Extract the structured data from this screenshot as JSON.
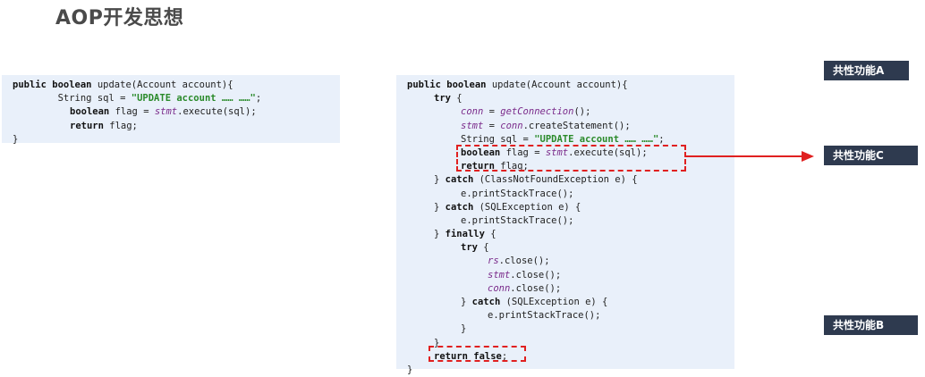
{
  "title": "AOP开发思想",
  "labels": {
    "common_a": "共性功能A",
    "common_c": "共性功能C",
    "common_b": "共性功能B"
  },
  "left_code": {
    "l1": {
      "kw1": "public boolean",
      "rest": " update(Account account){"
    },
    "l2": {
      "pre": "        String sql = ",
      "str": "\"UPDATE account …… ……\"",
      "post": ";"
    },
    "l3": {
      "kw": "boolean",
      "mid": " flag = ",
      "it": "stmt",
      "post": ".execute(sql);"
    },
    "l4": {
      "kw": "return",
      "post": " flag;"
    },
    "l5": "}"
  },
  "right_code": {
    "r1": {
      "kw": "public boolean",
      "rest": " update(Account account){"
    },
    "r2": {
      "kw": "try",
      "post": " {"
    },
    "r3": {
      "it": "conn",
      "post": " = ",
      "it2": "getConnection",
      "post2": "();"
    },
    "r4": {
      "it": "stmt",
      "post": " = ",
      "it2": "conn",
      "post2": ".createStatement();"
    },
    "r5": {
      "pre": "String sql = ",
      "str": "\"UPDATE account …… ……\"",
      "post": ";"
    },
    "r6": {
      "kw": "boolean",
      "mid": " flag = ",
      "it": "stmt",
      "post": ".execute(sql);"
    },
    "r7": {
      "kw": "return",
      "post": " flag;"
    },
    "r8": {
      "pre": "} ",
      "kw": "catch",
      "post": " (ClassNotFoundException e) {"
    },
    "r9": "e.printStackTrace();",
    "r10": {
      "pre": "} ",
      "kw": "catch",
      "post": " (SQLException e) {"
    },
    "r11": "e.printStackTrace();",
    "r12": {
      "pre": "} ",
      "kw": "finally",
      "post": " {"
    },
    "r13": {
      "kw": "try",
      "post": " {"
    },
    "r14": {
      "it": "rs",
      "post": ".close();"
    },
    "r15": {
      "it": "stmt",
      "post": ".close();"
    },
    "r16": {
      "it": "conn",
      "post": ".close();"
    },
    "r17": {
      "pre": "} ",
      "kw": "catch",
      "post": " (SQLException e) {"
    },
    "r18": "e.printStackTrace();",
    "r19": "}",
    "r20": "}",
    "r21": {
      "kw": "return false",
      "post": ";"
    },
    "r22": "}"
  }
}
